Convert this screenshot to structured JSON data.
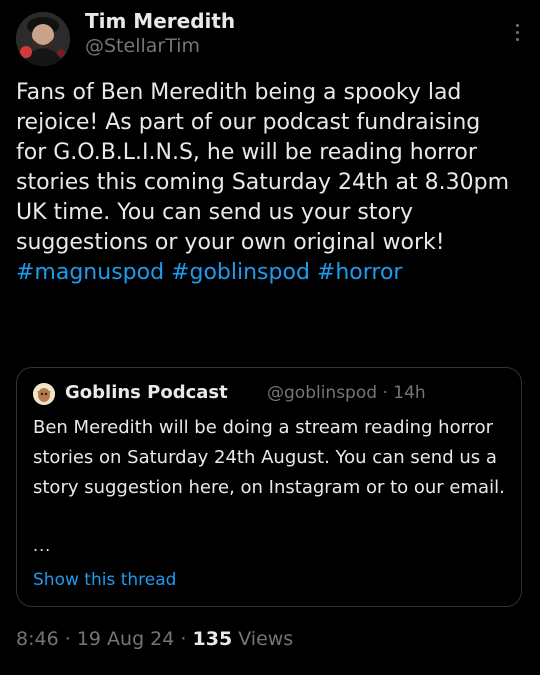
{
  "author": {
    "name": "Tim Meredith",
    "handle": "@StellarTim"
  },
  "tweet": {
    "text_plain": "Fans of Ben Meredith being a spooky lad rejoice! As part of our podcast fundraising for G.O.B.L.I.N.S, he will be reading horror stories this coming Saturday 24th at 8.30pm UK time. You can send us your story suggestions or your own original work!",
    "hashtags": [
      "#magnuspod",
      "#goblinspod",
      "#horror"
    ]
  },
  "quote": {
    "name": "Goblins Podcast",
    "handle": "@goblinspod",
    "separator": "·",
    "time": "14h",
    "text": "Ben Meredith will be doing a stream reading horror stories on Saturday 24th August. You can send us a story suggestion here, on Instagram or to our email.",
    "ellipsis": "...",
    "show_thread": "Show this thread"
  },
  "footer": {
    "time": "8:46",
    "separator": "·",
    "date": "19 Aug 24",
    "views_count": "135",
    "views_label": "Views"
  },
  "colors": {
    "background": "#000000",
    "text": "#e7e9ea",
    "muted": "#71767b",
    "link": "#1d9bf0",
    "border": "#2f3336"
  }
}
